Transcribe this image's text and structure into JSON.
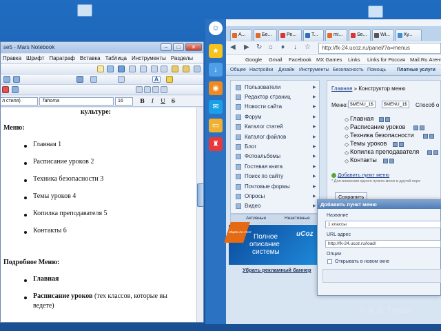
{
  "notebook": {
    "title": "se5 - Mars Notebook",
    "menu": [
      "Правка",
      "Шрифт",
      "Параграф",
      "Вставка",
      "Таблица",
      "Инструменты",
      "Разделы"
    ],
    "style_combo": "л стиля)",
    "font_combo": "Tahoma",
    "size_combo": "16",
    "format_buttons": [
      "B",
      "I",
      "U",
      "S"
    ],
    "doc": {
      "line_top": "культуре:",
      "menu_heading": "Меню:",
      "menu_items": [
        "Главная 1",
        "Расписание уроков 2",
        "Техника безопасности 3",
        "Темы уроков 4",
        "Копилка преподавателя 5",
        "Контакты 6"
      ],
      "detail_heading": "Подробное Меню:",
      "detail_item1": "Главная",
      "detail_item2_bold": "Расписание уроков",
      "detail_item2_rest": " (тех классов, которые вы",
      "detail_item2_cont": "ведете)"
    }
  },
  "browser": {
    "tabs": [
      "А...",
      "Бе...",
      "Ре...",
      "Т...",
      "mi...",
      "Se...",
      "Wi...",
      "Ку..."
    ],
    "url": "http://fk-24.ucoz.ru/panel/?a=menus",
    "bookmarks": [
      "Google",
      "Gmail",
      "Facebook",
      "MX Games",
      "Links",
      "Links for Россия",
      "Mail.Ru Агент"
    ],
    "ucoz_bar": [
      "Общее",
      "Настройки",
      "Дизайн",
      "Инструменты",
      "Безопасность",
      "Помощь"
    ],
    "ucoz_bar_right": "Платные услуги",
    "left_menu": [
      "Пользователи",
      "Редактор страниц",
      "Новости сайта",
      "Форум",
      "Каталог статей",
      "Каталог файлов",
      "Блог",
      "Фотоальбомы",
      "Гостевая книга",
      "Поиск по сайту",
      "Почтовые формы",
      "Опросы",
      "Видео"
    ],
    "left_tabs": [
      "Активные",
      "Неактивные"
    ],
    "banner": {
      "ribbon": "Ищем по стоп",
      "line1": "Полное",
      "line2": "описание",
      "line3": "системы",
      "logo": "uCoz"
    },
    "ad_link": "Убрать рекламный баннер",
    "constructor": {
      "breadcrumb_home": "Главная",
      "breadcrumb_rest": " » Конструктор меню",
      "menu_label": "Меню:",
      "menu_id1": "$MENU_1$",
      "menu_id2": "$MENU_1$",
      "menu_method": "Способ о",
      "items": [
        "Главная",
        "Расписание уроков",
        "Техника безопасности",
        "Темы уроков",
        "Копилка преподавателя",
        "Контакты"
      ],
      "add_item": "Добавить пункт меню",
      "hint": "* Для вложения одного пункта меню в другой пере",
      "save": "Сохранить"
    },
    "dialog": {
      "title": "Добавить пункт меню",
      "name_label": "Название",
      "name_value": "1 классы",
      "url_label": "URL адрес",
      "url_value": "http://fk-24.ucoz.ru/load/",
      "options_label": "Опции",
      "option_newwin": "Открывать в новом окне"
    }
  },
  "watermark": "© А.Н. Тяпин"
}
